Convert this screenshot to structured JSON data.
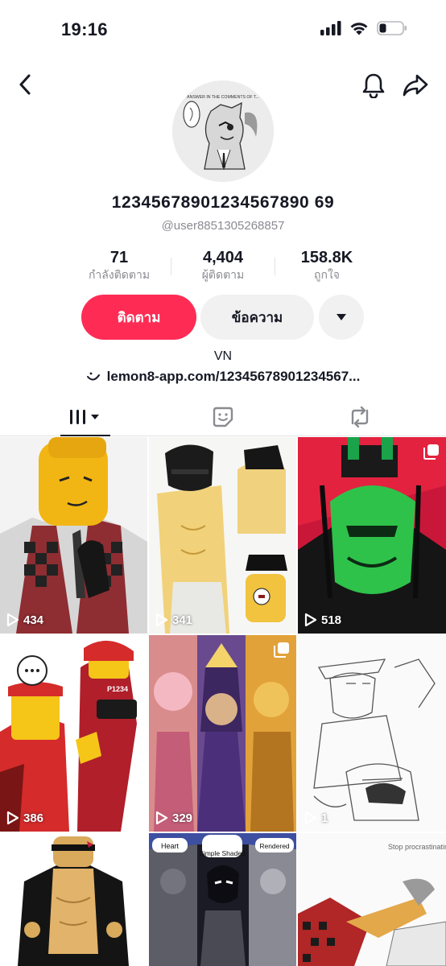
{
  "status_bar": {
    "time": "19:16",
    "icons": [
      "signal-icon",
      "wifi-icon",
      "battery-icon"
    ]
  },
  "nav": {
    "icons": [
      "back-icon",
      "bell-icon",
      "share-icon"
    ]
  },
  "profile": {
    "display_name": "12345678901234567890 69",
    "handle": "@user8851305268857",
    "avatar_text": "ANSWER IN THE COMMENTS OF T..."
  },
  "stats": [
    {
      "value": "71",
      "label": "กำลังติดตาม"
    },
    {
      "value": "4,404",
      "label": "ผู้ติดตาม"
    },
    {
      "value": "158.8K",
      "label": "ถูกใจ"
    }
  ],
  "actions": {
    "follow_label": "ติดตาม",
    "message_label": "ข้อความ"
  },
  "bio": "VN",
  "link": "lemon8-app.com/12345678901234567...",
  "tabs": {
    "icons": [
      "videos-grid-icon",
      "favorites-icon",
      "reposts-icon"
    ],
    "active": "videos-grid-icon"
  },
  "videos": [
    {
      "views": "434",
      "multi": false
    },
    {
      "views": "341",
      "multi": false
    },
    {
      "views": "518",
      "multi": true
    },
    {
      "views": "386",
      "multi": false
    },
    {
      "views": "329",
      "multi": true
    },
    {
      "views": "1",
      "multi": false
    },
    {
      "views": "",
      "multi": false
    },
    {
      "views": "",
      "multi": false
    },
    {
      "views": "",
      "multi": false
    }
  ],
  "thumbnail_text": {
    "video_4_badge": "P1234",
    "video_8_tags": [
      "Heart",
      "Simple Shaded",
      "Rendered"
    ],
    "video_9_caption": "Stop procrastinating and Lock IN"
  },
  "colors": {
    "accent": "#fe2c55",
    "secondary_button": "#f1f1f2",
    "muted_text": "#8a8b91"
  }
}
